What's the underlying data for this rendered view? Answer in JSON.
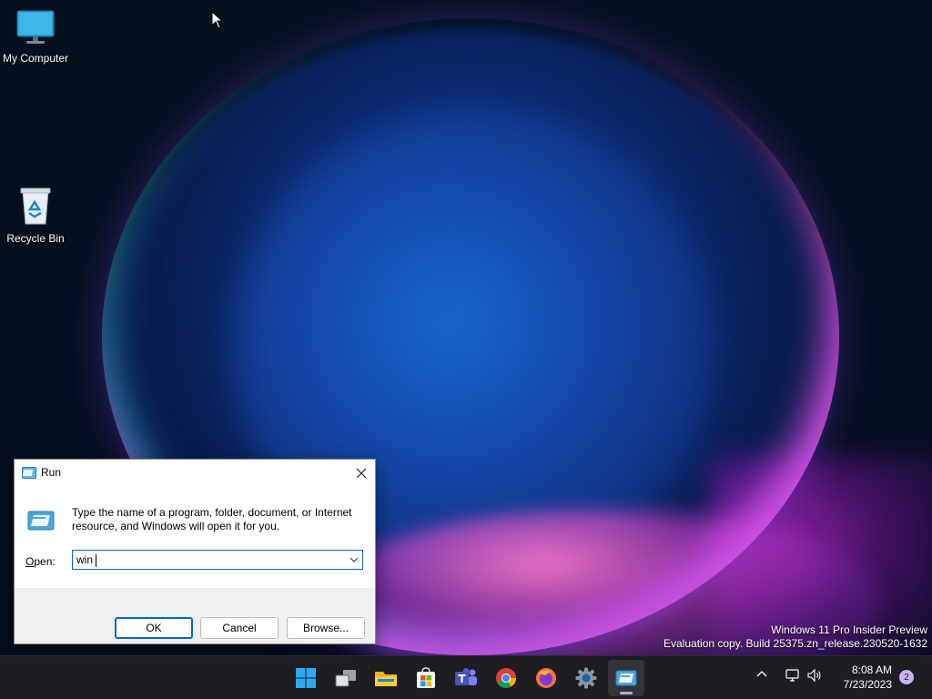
{
  "desktop": {
    "icons": [
      {
        "label": "My Computer",
        "icon": "monitor-icon"
      },
      {
        "label": "Recycle Bin",
        "icon": "recycle-bin-icon"
      }
    ],
    "watermark": {
      "line1": "Windows 11 Pro Insider Preview",
      "line2": "Evaluation copy. Build 25375.zn_release.230520-1632"
    }
  },
  "run_dialog": {
    "title": "Run",
    "description": "Type the name of a program, folder, document, or Internet resource, and Windows will open it for you.",
    "open_label_prefix": "",
    "open_label_accel": "O",
    "open_label_suffix": "pen:",
    "input_value": "win",
    "buttons": {
      "ok": "OK",
      "cancel": "Cancel",
      "browse": "Browse..."
    }
  },
  "taskbar": {
    "apps": [
      {
        "name": "start",
        "icon": "windows-logo-icon"
      },
      {
        "name": "task-view",
        "icon": "task-view-icon"
      },
      {
        "name": "file-explorer",
        "icon": "folder-icon"
      },
      {
        "name": "microsoft-store",
        "icon": "store-icon"
      },
      {
        "name": "teams",
        "icon": "teams-icon"
      },
      {
        "name": "chrome",
        "icon": "chrome-icon"
      },
      {
        "name": "firefox",
        "icon": "firefox-icon"
      },
      {
        "name": "settings",
        "icon": "gear-icon"
      },
      {
        "name": "run",
        "icon": "run-icon"
      }
    ],
    "tray": {
      "time": "8:08 AM",
      "date": "7/23/2023",
      "notification_count": "2"
    }
  },
  "colors": {
    "accent": "#0a64c8",
    "taskbar": "#1d1d22",
    "dialog_bg": "#f0f0f0"
  }
}
